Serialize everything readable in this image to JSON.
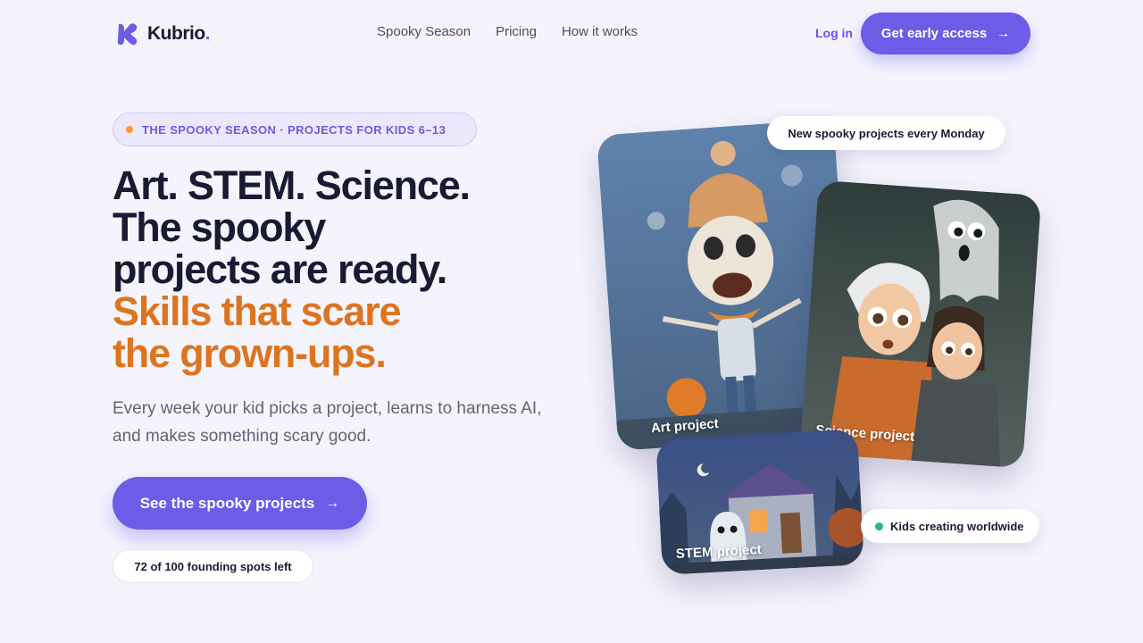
{
  "brand": {
    "name": "Kubrio",
    "dot": ".",
    "accent": "#6c5ce7"
  },
  "nav": {
    "links": [
      "Spooky Season",
      "Pricing",
      "How it works"
    ],
    "login": "Log in",
    "cta": "Get early access",
    "cta_arrow": "→"
  },
  "hero": {
    "eyebrow": "THE SPOOKY SEASON · PROJECTS FOR KIDS 6–13",
    "headline_lines": [
      "Art. STEM. Science.",
      "The spooky",
      "projects are ready."
    ],
    "headline_accent_lines": [
      "Skills that scare",
      "the grown-ups."
    ],
    "subtext": "Every week your kid picks a project, learns to harness AI, and makes something scary good.",
    "cta": "See the spooky projects",
    "cta_arrow": "→",
    "spots": "72 of 100 founding spots left"
  },
  "cards": {
    "art": "Art project",
    "science": "Science project",
    "stem": "STEM project"
  },
  "tags": {
    "monday": "New spooky projects every Monday",
    "worldwide": "Kids creating worldwide"
  },
  "colors": {
    "orange": "#dd7420",
    "pill_dot": "#f29a3c",
    "green": "#1fb88a"
  }
}
